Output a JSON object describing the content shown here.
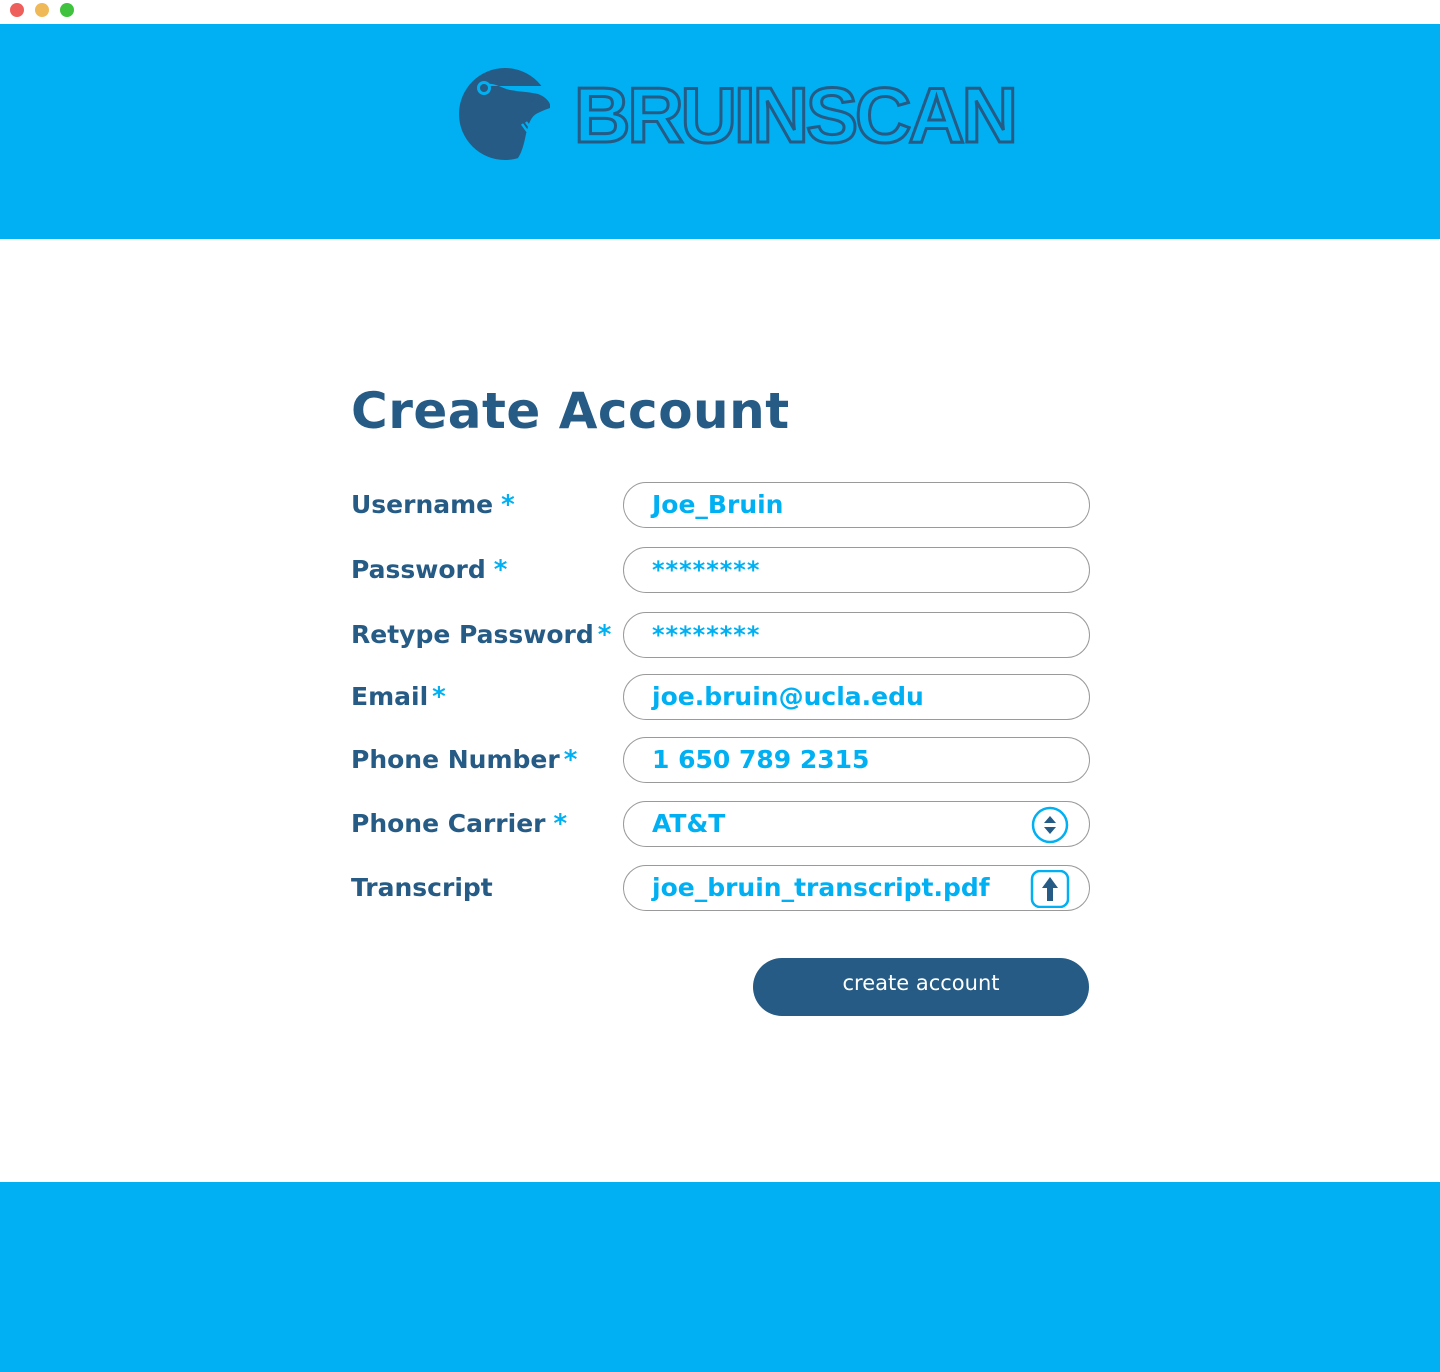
{
  "window": {
    "controls": [
      "close",
      "minimize",
      "maximize"
    ]
  },
  "brand": {
    "name": "BRUINSCAN",
    "logo_icon": "bear-head-icon",
    "primary_color": "#00b0f2",
    "dark_color": "#255b84"
  },
  "form": {
    "title": "Create Account",
    "required_marker": "*",
    "fields": [
      {
        "label": "Username",
        "value": "Joe_Bruin",
        "required": true
      },
      {
        "label": "Password",
        "value": "********",
        "required": true
      },
      {
        "label": "Retype Password",
        "value": "********",
        "required": true
      },
      {
        "label": "Email",
        "value": "joe.bruin@ucla.edu",
        "required": true
      },
      {
        "label": "Phone Number",
        "value": "1 650 789 2315",
        "required": true
      },
      {
        "label": "Phone Carrier",
        "value": "AT&T",
        "required": true,
        "icon": "select-arrows-icon"
      },
      {
        "label": "Transcript",
        "value": "joe_bruin_transcript.pdf",
        "required": false,
        "icon": "upload-icon"
      }
    ],
    "submit_label": "create account"
  }
}
